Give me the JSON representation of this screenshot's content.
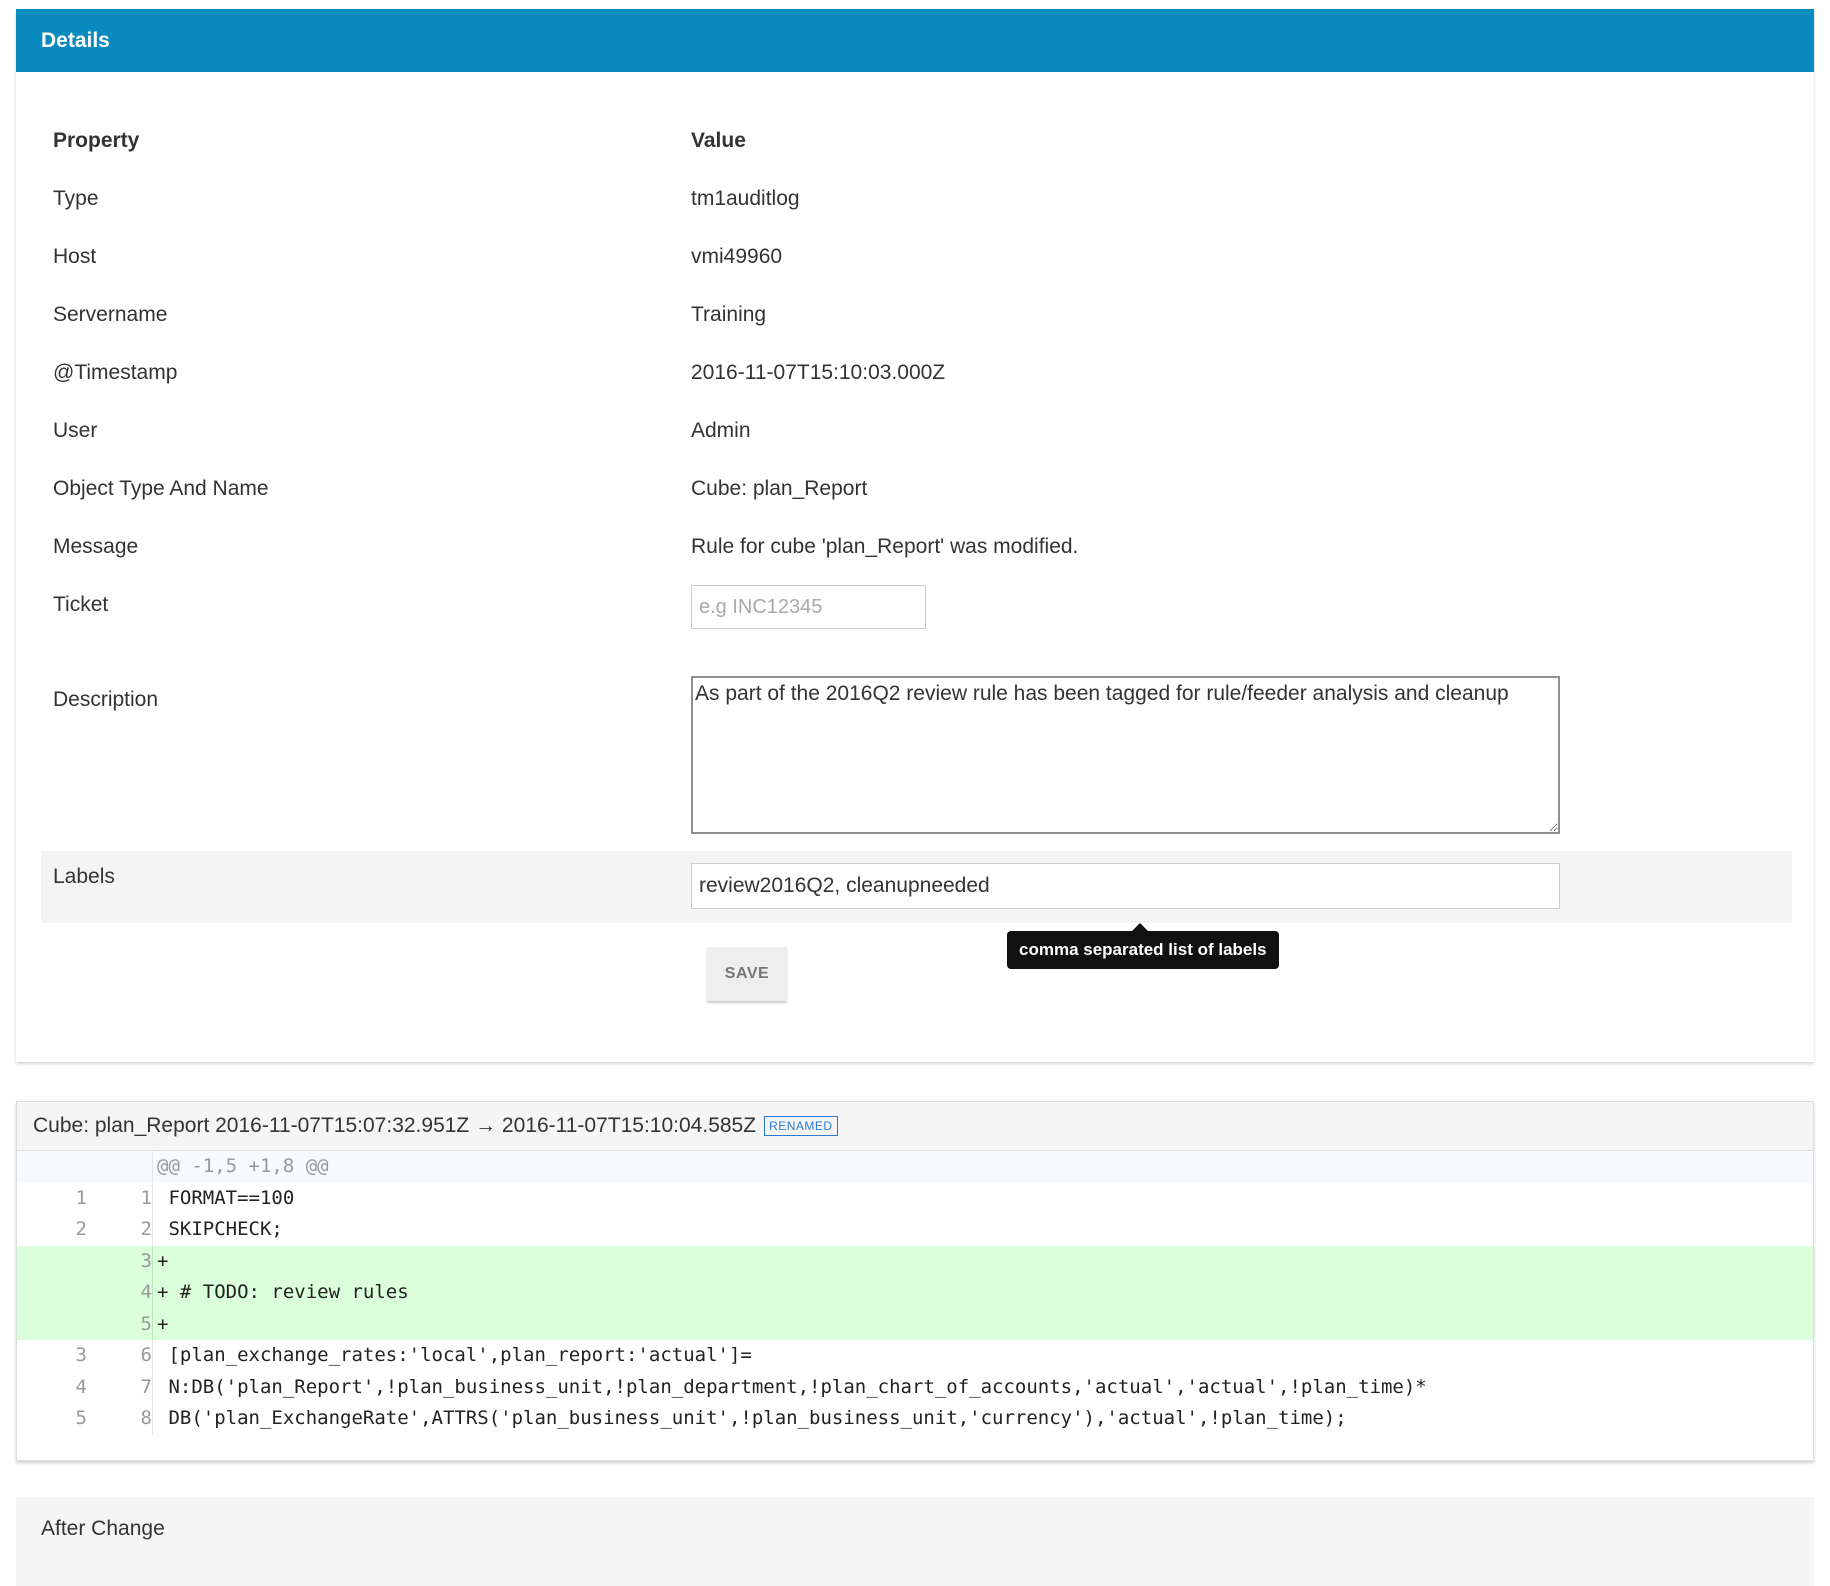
{
  "details": {
    "title": "Details",
    "header_property": "Property",
    "header_value": "Value",
    "rows": [
      {
        "key": "Type",
        "value": "tm1auditlog"
      },
      {
        "key": "Host",
        "value": "vmi49960"
      },
      {
        "key": "Servername",
        "value": "Training"
      },
      {
        "key": "@Timestamp",
        "value": "2016-11-07T15:10:03.000Z"
      },
      {
        "key": "User",
        "value": "Admin"
      },
      {
        "key": "Object Type And Name",
        "value": "Cube: plan_Report"
      },
      {
        "key": "Message",
        "value": "Rule for cube 'plan_Report' was modified."
      }
    ],
    "ticket_label": "Ticket",
    "ticket_placeholder": "e.g INC12345",
    "description_label": "Description",
    "description_value": "As part of the 2016Q2 review rule has been tagged for rule/feeder analysis and cleanup",
    "labels_label": "Labels",
    "labels_value": "review2016Q2, cleanupneeded",
    "labels_tooltip": "comma separated list of labels",
    "save_label": "SAVE"
  },
  "diff": {
    "title": "Cube: plan_Report 2016-11-07T15:07:32.951Z → 2016-11-07T15:10:04.585Z",
    "badge": "RENAMED",
    "hunk": "@@ -1,5 +1,8 @@",
    "lines": [
      {
        "old": "1",
        "new": "1",
        "text": " FORMAT==100",
        "type": "ctx"
      },
      {
        "old": "2",
        "new": "2",
        "text": " SKIPCHECK;",
        "type": "ctx"
      },
      {
        "old": "",
        "new": "3",
        "text": "+",
        "type": "add"
      },
      {
        "old": "",
        "new": "4",
        "text": "+ # TODO: review rules",
        "type": "add"
      },
      {
        "old": "",
        "new": "5",
        "text": "+",
        "type": "add"
      },
      {
        "old": "3",
        "new": "6",
        "text": " [plan_exchange_rates:'local',plan_report:'actual']=",
        "type": "ctx"
      },
      {
        "old": "4",
        "new": "7",
        "text": " N:DB('plan_Report',!plan_business_unit,!plan_department,!plan_chart_of_accounts,'actual','actual',!plan_time)*",
        "type": "ctx"
      },
      {
        "old": "5",
        "new": "8",
        "text": " DB('plan_ExchangeRate',ATTRS('plan_business_unit',!plan_business_unit,'currency'),'actual',!plan_time);",
        "type": "ctx"
      }
    ]
  },
  "after": {
    "title": "After Change"
  },
  "colors": {
    "header_blue": "#0a8bbf",
    "added_line_bg": "#dbffdb",
    "badge_blue": "#2a7bd0"
  }
}
